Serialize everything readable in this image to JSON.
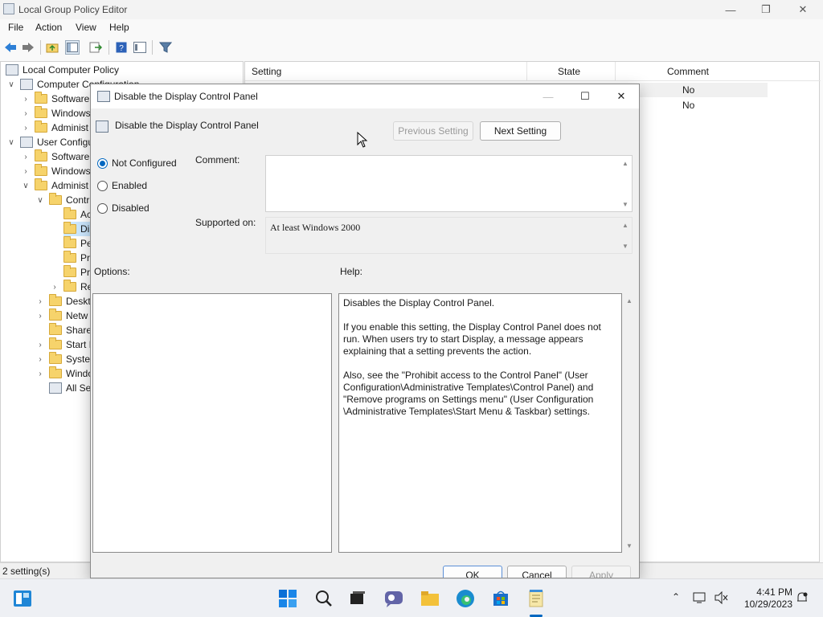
{
  "window": {
    "title": "Local Group Policy Editor"
  },
  "menu": [
    "File",
    "Action",
    "View",
    "Help"
  ],
  "tree": {
    "root": "Local Computer Policy",
    "items": [
      {
        "label": "Computer Configuration",
        "level": 1,
        "expander": "open",
        "icon": "policy"
      },
      {
        "label": "Software",
        "level": 2,
        "expander": "closed",
        "icon": "folder"
      },
      {
        "label": "Windows",
        "level": 2,
        "expander": "closed",
        "icon": "folder"
      },
      {
        "label": "Administ",
        "level": 2,
        "expander": "closed",
        "icon": "folder"
      },
      {
        "label": "User Configu",
        "level": 1,
        "expander": "open",
        "icon": "policy"
      },
      {
        "label": "Software",
        "level": 2,
        "expander": "closed",
        "icon": "folder"
      },
      {
        "label": "Windows",
        "level": 2,
        "expander": "closed",
        "icon": "folder"
      },
      {
        "label": "Administ",
        "level": 2,
        "expander": "open",
        "icon": "folder"
      },
      {
        "label": "Contr",
        "level": 3,
        "expander": "open",
        "icon": "folder"
      },
      {
        "label": "Ac",
        "level": 4,
        "expander": "none",
        "icon": "folder"
      },
      {
        "label": "Di",
        "level": 4,
        "expander": "none",
        "icon": "folder",
        "selected": true
      },
      {
        "label": "Pe",
        "level": 4,
        "expander": "none",
        "icon": "folder"
      },
      {
        "label": "Pr",
        "level": 4,
        "expander": "none",
        "icon": "folder"
      },
      {
        "label": "Pr",
        "level": 4,
        "expander": "none",
        "icon": "folder"
      },
      {
        "label": "Re",
        "level": 4,
        "expander": "closed",
        "icon": "folder"
      },
      {
        "label": "Deskt",
        "level": 3,
        "expander": "closed",
        "icon": "folder"
      },
      {
        "label": "Netw",
        "level": 3,
        "expander": "closed",
        "icon": "folder"
      },
      {
        "label": "Share",
        "level": 3,
        "expander": "none",
        "icon": "folder"
      },
      {
        "label": "Start I",
        "level": 3,
        "expander": "closed",
        "icon": "folder"
      },
      {
        "label": "Syster",
        "level": 3,
        "expander": "closed",
        "icon": "folder"
      },
      {
        "label": "Windo",
        "level": 3,
        "expander": "closed",
        "icon": "folder"
      },
      {
        "label": "All Se",
        "level": 3,
        "expander": "none",
        "icon": "policy"
      }
    ]
  },
  "list": {
    "columns": {
      "setting": "Setting",
      "state": "State",
      "comment": "Comment"
    },
    "rows": [
      {
        "setting": "",
        "state": "",
        "comment": "No"
      },
      {
        "setting": "",
        "state": "",
        "comment": "No"
      }
    ]
  },
  "status": {
    "text": "2 setting(s)"
  },
  "dialog": {
    "title": "Disable the Display Control Panel",
    "header": "Disable the Display Control Panel",
    "prev_button": "Previous Setting",
    "next_button": "Next Setting",
    "radios": [
      {
        "label": "Not Configured",
        "checked": true
      },
      {
        "label": "Enabled",
        "checked": false
      },
      {
        "label": "Disabled",
        "checked": false
      }
    ],
    "comment_label": "Comment:",
    "comment_value": "",
    "supported_label": "Supported on:",
    "supported_value": "At least Windows 2000",
    "options_label": "Options:",
    "help_label": "Help:",
    "help_text": "Disables the Display Control Panel.\n\nIf you enable this setting, the Display Control Panel does not run. When users try to start Display, a message appears explaining that a setting prevents the action.\n\nAlso, see the \"Prohibit access to the Control Panel\" (User Configuration\\Administrative Templates\\Control Panel) and \"Remove programs on Settings menu\" (User Configuration \\Administrative Templates\\Start Menu & Taskbar) settings.",
    "ok_button": "OK",
    "cancel_button": "Cancel",
    "apply_button": "Apply"
  },
  "taskbar": {
    "apps": [
      "widgets-icon",
      "start-icon",
      "search-icon",
      "task-view-icon",
      "chat-icon",
      "file-explorer-icon",
      "edge-icon",
      "store-icon",
      "notepad-icon"
    ],
    "time": "4:41 PM",
    "date": "10/29/2023"
  },
  "colors": {
    "accent": "#0067c0",
    "folder": "#f6d36b",
    "selection": "#cce8ff"
  }
}
